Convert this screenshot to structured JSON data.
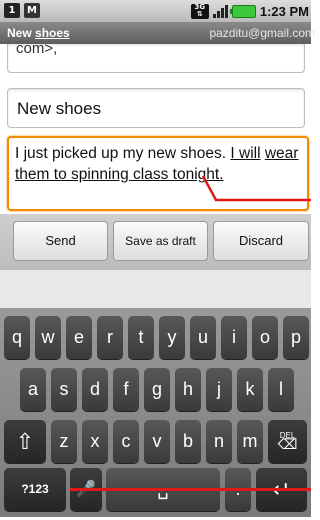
{
  "status_bar": {
    "notification_icons": [
      "1",
      "M"
    ],
    "network_label": "3G",
    "time": "1:23 PM"
  },
  "title_bar": {
    "subject": "New ",
    "subject_underlined": "shoes",
    "account": "pazditu@gmail.com"
  },
  "compose": {
    "to_value": "com>,",
    "subject_value": "New shoes",
    "body_plain": "I just picked up my new shoes. ",
    "body_underlined_1": "I will",
    "body_underlined_2": "wear them to spinning class tonight."
  },
  "buttons": {
    "send": "Send",
    "save_draft": "Save as draft",
    "discard": "Discard"
  },
  "keyboard": {
    "row1": [
      "q",
      "w",
      "e",
      "r",
      "t",
      "y",
      "u",
      "i",
      "o",
      "p"
    ],
    "row2": [
      "a",
      "s",
      "d",
      "f",
      "g",
      "h",
      "j",
      "k",
      "l"
    ],
    "row3": [
      "z",
      "x",
      "c",
      "v",
      "b",
      "n",
      "m"
    ],
    "shift": "⇧",
    "del_label": "DEL",
    "del_glyph": "⌫",
    "symbols": "?123",
    "mic": "🎤",
    "space": "␣",
    "period": ".",
    "enter": "↵"
  },
  "colors": {
    "focus_border": "#f08a00",
    "annotation_red": "#e01818"
  }
}
